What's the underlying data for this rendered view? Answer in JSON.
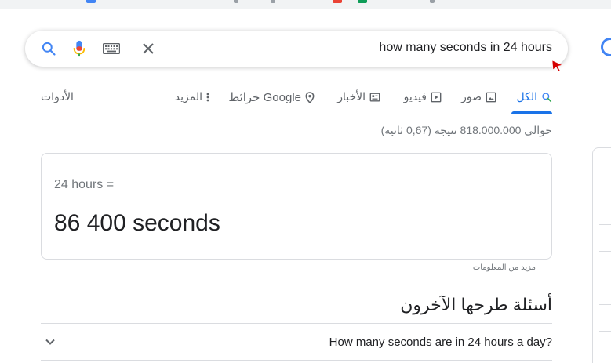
{
  "search": {
    "query": "how many seconds in 24 hours"
  },
  "tabs": {
    "all": "الكل",
    "images": "صور",
    "videos": "فيديو",
    "news": "الأخبار",
    "maps": "خرائط Google",
    "more": "المزيد",
    "tools": "الأدوات"
  },
  "stats": {
    "text": "حوالى 818.000.000 نتيجة (0,67 ثانية)"
  },
  "converter": {
    "equation": "24 hours =",
    "result": "86 400 seconds"
  },
  "more_info": "مزيد من المعلومات",
  "paa": {
    "title": "أسئلة طرحها الآخرون",
    "question1": "How many seconds are in 24 hours a day?"
  },
  "colors": {
    "accent": "#1a73e8",
    "text": "#202124",
    "muted": "#70757a"
  }
}
